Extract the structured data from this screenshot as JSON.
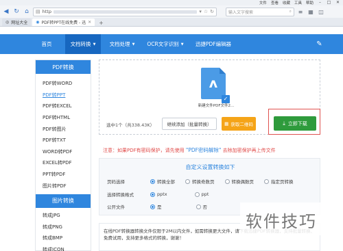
{
  "browser": {
    "titlebar": {
      "items": [
        "文件",
        "查看",
        "收藏",
        "工具",
        "帮助"
      ]
    },
    "url_prefix": "http",
    "search_placeholder": "输入文字搜索",
    "tabs": [
      {
        "label": "网址大全",
        "active": false
      },
      {
        "label": "PDF转PPT在线免费 - 迅",
        "active": true
      }
    ]
  },
  "nav": {
    "items": [
      {
        "label": "首页",
        "active": false,
        "caret": false
      },
      {
        "label": "文档转换",
        "active": true,
        "caret": true
      },
      {
        "label": "文档处理",
        "active": false,
        "caret": true
      },
      {
        "label": "OCR文字识别",
        "active": false,
        "caret": true
      },
      {
        "label": "迅捷PDF编辑器",
        "active": false,
        "caret": false
      }
    ],
    "edit_icon": "edit-icon"
  },
  "sidebar": {
    "section1_title": "PDF转换",
    "section1_items": [
      "PDF转WORD",
      "PDF转PPT",
      "PDF转EXCEL",
      "PDF转HTML",
      "PDF转图片",
      "PDF转TXT",
      "WORD转PDF",
      "EXCEL转PDF",
      "PPT转PDF",
      "图片转PDF"
    ],
    "active_item": "PDF转PPT",
    "section2_title": "图片转换",
    "section2_items": [
      "转成JPG",
      "转成PNG",
      "转成BMP",
      "转成ICON"
    ]
  },
  "upload": {
    "filename": "新建文件PDF文件2...",
    "selected_info": "选中1个（共338.43K）",
    "add_button": "继续添加（批量转换）",
    "qr_button": "获取二维码",
    "download_button": "立即下载"
  },
  "notice": {
    "prefix": "注意：如果PDF有密码保护，请先使用",
    "link": "\"PDF密码解除\"",
    "suffix": "去除加密保护再上传文件"
  },
  "settings": {
    "title": "自定义设置转换如下",
    "rows": [
      {
        "label": "页码选择",
        "options": [
          "转换全部",
          "转换奇数页",
          "转换偶数页",
          "指定页转换"
        ],
        "selected": 0
      },
      {
        "label": "选择转换格式",
        "options": [
          "pptx",
          "ppt"
        ],
        "selected": 0
      },
      {
        "label": "公开文件",
        "options": [
          "是",
          "否"
        ],
        "selected": 0
      }
    ]
  },
  "bottom_note": "在线PDF转换器转换文件仅限于2M以内文件，如需转换更大文件，请下载迅捷PDF转换器，支持批量转换、免费试用，支持更多格式的转换，谢谢！",
  "watermark": "软件技巧"
}
